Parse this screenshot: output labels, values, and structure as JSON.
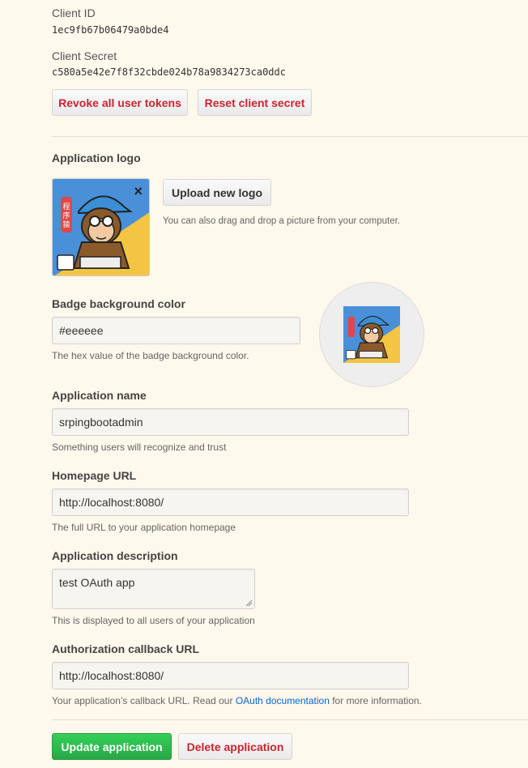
{
  "credentials": {
    "client_id_label": "Client ID",
    "client_id_value": "1ec9fb67b06479a0bde4",
    "client_secret_label": "Client Secret",
    "client_secret_value": "c580a5e42e7f8f32cbde024b78a9834273ca0ddc",
    "revoke_label": "Revoke all user tokens",
    "reset_label": "Reset client secret"
  },
  "logo": {
    "section_label": "Application logo",
    "upload_label": "Upload new logo",
    "upload_hint": "You can also drag and drop a picture from your computer.",
    "remove_glyph": "×"
  },
  "badge": {
    "label": "Badge background color",
    "value": "#eeeeee",
    "hint": "The hex value of the badge background color."
  },
  "form": {
    "name_label": "Application name",
    "name_value": "srpingbootadmin",
    "name_hint": "Something users will recognize and trust",
    "homepage_label": "Homepage URL",
    "homepage_value": "http://localhost:8080/",
    "homepage_hint": "The full URL to your application homepage",
    "description_label": "Application description",
    "description_value": "test OAuth app",
    "description_hint": "This is displayed to all users of your application",
    "callback_label": "Authorization callback URL",
    "callback_value": "http://localhost:8080/",
    "callback_hint_prefix": "Your application’s callback URL. Read our ",
    "callback_hint_link": "OAuth documentation",
    "callback_hint_suffix": " for more information."
  },
  "actions": {
    "update_label": "Update application",
    "delete_label": "Delete application"
  },
  "colors": {
    "page_bg": "#fff8ec",
    "danger": "#cb2431",
    "primary": "#28a745",
    "link": "#0366d6"
  }
}
